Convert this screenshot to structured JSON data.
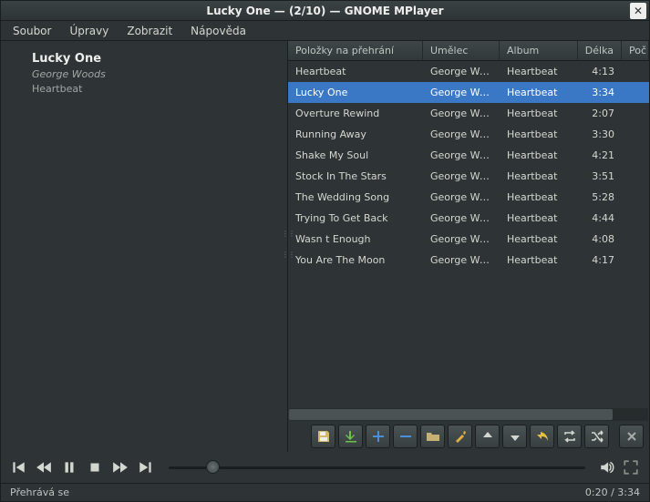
{
  "window": {
    "title": "Lucky One — (2/10) — GNOME MPlayer"
  },
  "menu": {
    "items": [
      "Soubor",
      "Úpravy",
      "Zobrazit",
      "Nápověda"
    ]
  },
  "now_playing": {
    "title": "Lucky One",
    "artist": "George Woods",
    "album": "Heartbeat"
  },
  "playlist": {
    "columns": {
      "title": "Položky na přehrání",
      "artist": "Umělec",
      "album": "Album",
      "length": "Délka",
      "count": "Poč"
    },
    "selected_index": 1,
    "tracks": [
      {
        "title": "Heartbeat",
        "artist": "George Woods",
        "album": "Heartbeat",
        "length": "4:13"
      },
      {
        "title": "Lucky One",
        "artist": "George Woods",
        "album": "Heartbeat",
        "length": "3:34"
      },
      {
        "title": "Overture Rewind",
        "artist": "George Woods",
        "album": "Heartbeat",
        "length": "2:07"
      },
      {
        "title": "Running Away",
        "artist": "George Woods",
        "album": "Heartbeat",
        "length": "3:30"
      },
      {
        "title": "Shake My Soul",
        "artist": "George Woods",
        "album": "Heartbeat",
        "length": "4:21"
      },
      {
        "title": "Stock In The Stars",
        "artist": "George Woods",
        "album": "Heartbeat",
        "length": "3:51"
      },
      {
        "title": "The Wedding Song",
        "artist": "George Woods",
        "album": "Heartbeat",
        "length": "5:28"
      },
      {
        "title": "Trying To Get Back",
        "artist": "George Woods",
        "album": "Heartbeat",
        "length": "4:44"
      },
      {
        "title": "Wasn t Enough",
        "artist": "George Woods",
        "album": "Heartbeat",
        "length": "4:08"
      },
      {
        "title": "You Are The Moon",
        "artist": "George Woods",
        "album": "Heartbeat",
        "length": "4:17"
      }
    ]
  },
  "toolbar_icons": {
    "save": "save-icon",
    "download": "download-icon",
    "add": "plus-icon",
    "remove": "minus-icon",
    "open": "folder-icon",
    "clear": "broom-icon",
    "up": "up-icon",
    "down": "down-icon",
    "undo": "undo-icon",
    "loop": "loop-icon",
    "shuffle": "shuffle-icon",
    "close": "x-icon"
  },
  "transport": {
    "position_fraction": 0.104
  },
  "status": {
    "state": "Přehrává se",
    "time": "0:20 /  3:34"
  }
}
